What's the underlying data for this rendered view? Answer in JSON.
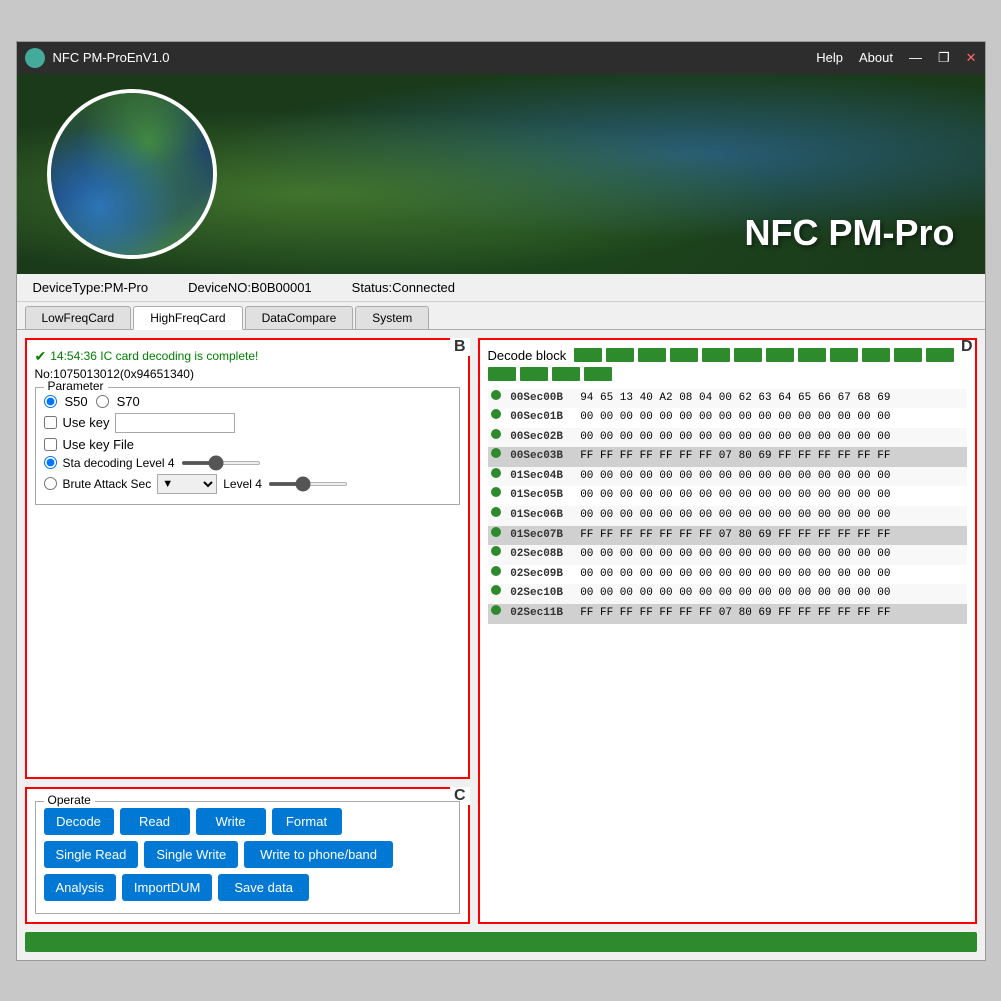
{
  "titleBar": {
    "icon": "nfc-icon",
    "title": "NFC PM-ProEnV1.0",
    "helpLabel": "Help",
    "aboutLabel": "About",
    "minimizeLabel": "—",
    "maximizeLabel": "❐",
    "closeLabel": "✕"
  },
  "brand": {
    "text": "NFC PM-Pro"
  },
  "infoBar": {
    "deviceType": "DeviceType:PM-Pro",
    "deviceNo": "DeviceNO:B0B00001",
    "status": "Status:Connected"
  },
  "tabs": [
    {
      "label": "LowFreqCard",
      "active": false
    },
    {
      "label": "HighFreqCard",
      "active": true
    },
    {
      "label": "DataCompare",
      "active": false
    },
    {
      "label": "System",
      "active": false
    }
  ],
  "panelB": {
    "label": "B",
    "statusMsg": "14:54:36 IC card decoding is complete!",
    "cardNo": "No:1075013012(0x94651340)",
    "paramGroup": {
      "legend": "Parameter",
      "s50Label": "S50",
      "s70Label": "S70",
      "useKeyLabel": "Use key",
      "useKeyFileLabel": "Use key File",
      "staDecodingLabel": "Sta decoding  Level 4",
      "bruteAttackLabel": "Brute Attack Sec",
      "level4Label": "Level 4"
    }
  },
  "panelC": {
    "label": "C",
    "operateLabel": "Operate",
    "buttons": {
      "decode": "Decode",
      "read": "Read",
      "write": "Write",
      "format": "Format",
      "singleRead": "Single Read",
      "singleWrite": "Single Write",
      "writeToPhone": "Write to phone/band",
      "analysis": "Analysis",
      "importDump": "ImportDUM",
      "saveData": "Save data"
    }
  },
  "panelD": {
    "label": "D",
    "decodeBlockLabel": "Decode block",
    "blockCount": 16,
    "rows": [
      {
        "dot": true,
        "addr": "00Sec00B",
        "data": "94 65 13 40 A2 08 04 00 62 63 64 65 66 67 68 69",
        "highlight": false
      },
      {
        "dot": true,
        "addr": "00Sec01B",
        "data": "00 00 00 00 00 00 00 00 00 00 00 00 00 00 00 00",
        "highlight": false
      },
      {
        "dot": true,
        "addr": "00Sec02B",
        "data": "00 00 00 00 00 00 00 00 00 00 00 00 00 00 00 00",
        "highlight": false
      },
      {
        "dot": true,
        "addr": "00Sec03B",
        "data": "FF FF FF FF FF FF FF 07 80 69 FF FF FF FF FF FF",
        "highlight": true
      },
      {
        "dot": true,
        "addr": "01Sec04B",
        "data": "00 00 00 00 00 00 00 00 00 00 00 00 00 00 00 00",
        "highlight": false
      },
      {
        "dot": true,
        "addr": "01Sec05B",
        "data": "00 00 00 00 00 00 00 00 00 00 00 00 00 00 00 00",
        "highlight": false
      },
      {
        "dot": true,
        "addr": "01Sec06B",
        "data": "00 00 00 00 00 00 00 00 00 00 00 00 00 00 00 00",
        "highlight": false
      },
      {
        "dot": true,
        "addr": "01Sec07B",
        "data": "FF FF FF FF FF FF FF 07 80 69 FF FF FF FF FF FF",
        "highlight": true
      },
      {
        "dot": true,
        "addr": "02Sec08B",
        "data": "00 00 00 00 00 00 00 00 00 00 00 00 00 00 00 00",
        "highlight": false
      },
      {
        "dot": true,
        "addr": "02Sec09B",
        "data": "00 00 00 00 00 00 00 00 00 00 00 00 00 00 00 00",
        "highlight": false
      },
      {
        "dot": true,
        "addr": "02Sec10B",
        "data": "00 00 00 00 00 00 00 00 00 00 00 00 00 00 00 00",
        "highlight": false
      },
      {
        "dot": true,
        "addr": "02Sec11B",
        "data": "FF FF FF FF FF FF FF 07 80 69 FF FF FF FF FF FF",
        "highlight": true
      }
    ]
  },
  "statusBar": {
    "color": "#2d8a2d"
  }
}
